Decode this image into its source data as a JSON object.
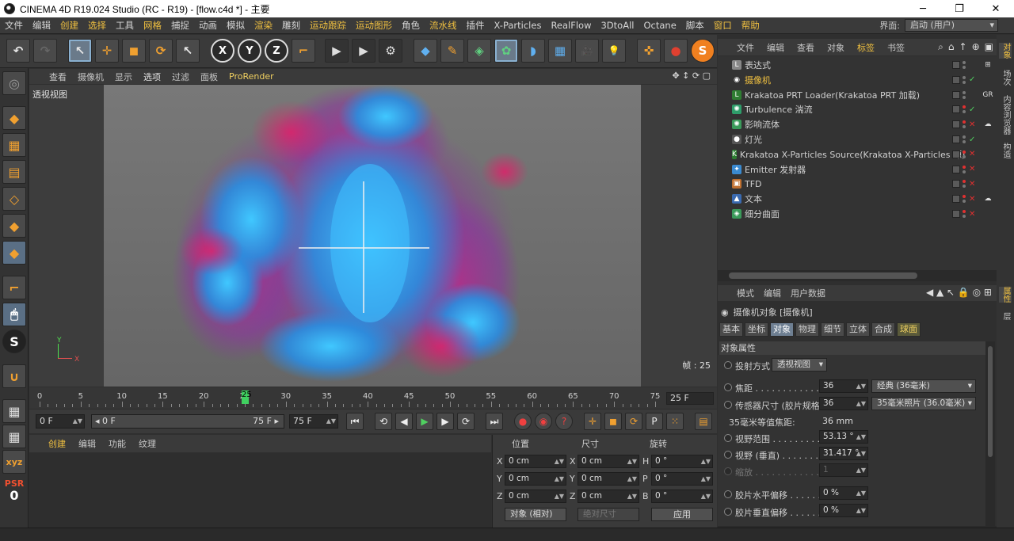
{
  "window": {
    "title": "CINEMA 4D R19.024 Studio (RC - R19) - [flow.c4d *] - 主要",
    "minimize": "─",
    "maximize": "❐",
    "close": "✕"
  },
  "menubar": {
    "items": [
      "文件",
      "编辑",
      "创建",
      "选择",
      "工具",
      "网格",
      "捕捉",
      "动画",
      "模拟",
      "渲染",
      "雕刻",
      "运动跟踪",
      "运动图形",
      "角色",
      "流水线",
      "插件",
      "X-Particles",
      "RealFlow",
      "3DtoAll",
      "Octane",
      "脚本",
      "窗口",
      "帮助"
    ],
    "layout_label": "界面:",
    "layout_value": "启动 (用户)"
  },
  "toolbar": {
    "undo": "↶",
    "redo": "↷",
    "live_select": "↖",
    "move": "✛",
    "scale": "◼",
    "rotate": "⟳",
    "recent": "↖",
    "axis_x": "X",
    "axis_y": "Y",
    "axis_z": "Z",
    "coord_system": "⌐",
    "render_view": "▶",
    "render_pv": "▶",
    "render_settings": "⚙",
    "cube": "◆",
    "pen": "✎",
    "subdiv": "◈",
    "cloner": "✿",
    "deformer": "◗",
    "floor": "▦",
    "camera": "🎥",
    "light": "💡",
    "symmetry": "✜",
    "xp": "●",
    "spline_s": "S"
  },
  "viewport": {
    "menu": [
      "查看",
      "摄像机",
      "显示",
      "选项",
      "过滤",
      "面板",
      "ProRender"
    ],
    "nav_icons": "✥ ↕ ⟳ ▢",
    "label": "透视视图",
    "frame_label": "帧 : 25",
    "axis_y": "Y",
    "axis_x": "X"
  },
  "timeline": {
    "ticks": [
      "0",
      "5",
      "10",
      "15",
      "20",
      "25",
      "30",
      "35",
      "40",
      "45",
      "50",
      "55",
      "60",
      "65",
      "70",
      "75"
    ],
    "current": "25",
    "end": "25 F"
  },
  "transport": {
    "start_field": "0 F",
    "range_start": "◂ 0 F",
    "range_end": "75 F ▸",
    "end_field": "75 F"
  },
  "create_panel": {
    "tabs": [
      "创建",
      "编辑",
      "功能",
      "纹理"
    ]
  },
  "coord_panel": {
    "headers": [
      "位置",
      "尺寸",
      "旋转"
    ],
    "rows": [
      {
        "axis": "X",
        "pos": "0 cm",
        "size_axis": "X",
        "size": "0 cm",
        "rot_axis": "H",
        "rot": "0 °"
      },
      {
        "axis": "Y",
        "pos": "0 cm",
        "size_axis": "Y",
        "size": "0 cm",
        "rot_axis": "P",
        "rot": "0 °"
      },
      {
        "axis": "Z",
        "pos": "0 cm",
        "size_axis": "Z",
        "size": "0 cm",
        "rot_axis": "B",
        "rot": "0 °"
      }
    ],
    "mode": "对象 (相对)",
    "size_mode": "绝对尺寸",
    "apply": "应用"
  },
  "left_tools": {
    "psr": "PSR",
    "psr_value": "0"
  },
  "object_manager": {
    "menu": [
      "文件",
      "编辑",
      "查看",
      "对象",
      "标签",
      "书签"
    ],
    "objects": [
      {
        "name": "表达式",
        "icon_color": "#888888",
        "icon": "L"
      },
      {
        "name": "摄像机",
        "icon_color": "#333333",
        "icon": "◉"
      },
      {
        "name": "Krakatoa PRT Loader(Krakatoa PRT 加载)",
        "icon_color": "#2e7d32",
        "icon": "L"
      },
      {
        "name": "Turbulence 湍流",
        "icon_color": "#2e9d6a",
        "icon": "✺"
      },
      {
        "name": "影响流体",
        "icon_color": "#3a9a5a",
        "icon": "✺"
      },
      {
        "name": "灯光",
        "icon_color": "#555555",
        "icon": "●"
      },
      {
        "name": "Krakatoa X-Particles Source(Krakatoa X-Particles 源)",
        "icon_color": "#2e7d32",
        "icon": "K"
      },
      {
        "name": "Emitter 发射器",
        "icon_color": "#3a8ad0",
        "icon": "✦"
      },
      {
        "name": "TFD",
        "icon_color": "#c07030",
        "icon": "▣"
      },
      {
        "name": "文本",
        "icon_color": "#3a6ab0",
        "icon": "▲"
      },
      {
        "name": "细分曲面",
        "icon_color": "#3a9a5a",
        "icon": "◈"
      }
    ],
    "tags": [
      "⊞",
      "",
      "GR",
      "",
      "☁",
      "",
      "",
      "",
      "",
      "☁",
      ""
    ]
  },
  "attribute_manager": {
    "menu": [
      "模式",
      "编辑",
      "用户数据"
    ],
    "nav": "◀ ▲ ↖ 🔒 ◎ ⊞",
    "title": "摄像机对象 [摄像机]",
    "tabs": [
      "基本",
      "坐标",
      "对象",
      "物理",
      "细节",
      "立体",
      "合成",
      "球面"
    ],
    "section": "对象属性",
    "projection_label": "投射方式",
    "projection_value": "透视视图",
    "focal_label": "焦距 . . . . . . . . . . . . . .",
    "focal_value": "36",
    "focal_preset": "经典 (36毫米)",
    "sensor_label": "传感器尺寸 (胶片规格)",
    "sensor_value": "36",
    "sensor_preset": "35毫米照片 (36.0毫米)",
    "equiv_label": "35毫米等值焦距:",
    "equiv_value": "36 mm",
    "fov_label": "视野范围 . . . . . . . . . . .",
    "fov_value": "53.13 °",
    "fov_v_label": "视野 (垂直) . . . . . . . . .",
    "fov_v_value": "31.417 °",
    "zoom_label": "缩放 . . . . . . . . . . . . . .",
    "zoom_value": "1",
    "shift_x_label": "胶片水平偏移 . . . . . . .",
    "shift_x_value": "0 %",
    "shift_y_label": "胶片垂直偏移 . . . . . . .",
    "shift_y_value": "0 %"
  },
  "right_tabs": [
    "对象",
    "场次",
    "内容浏览器",
    "构造",
    "属性",
    "层"
  ],
  "colors": {
    "accent_yellow": "#f0c040",
    "particle_blue": "#2aa8f0",
    "particle_magenta": "#d0206a"
  }
}
